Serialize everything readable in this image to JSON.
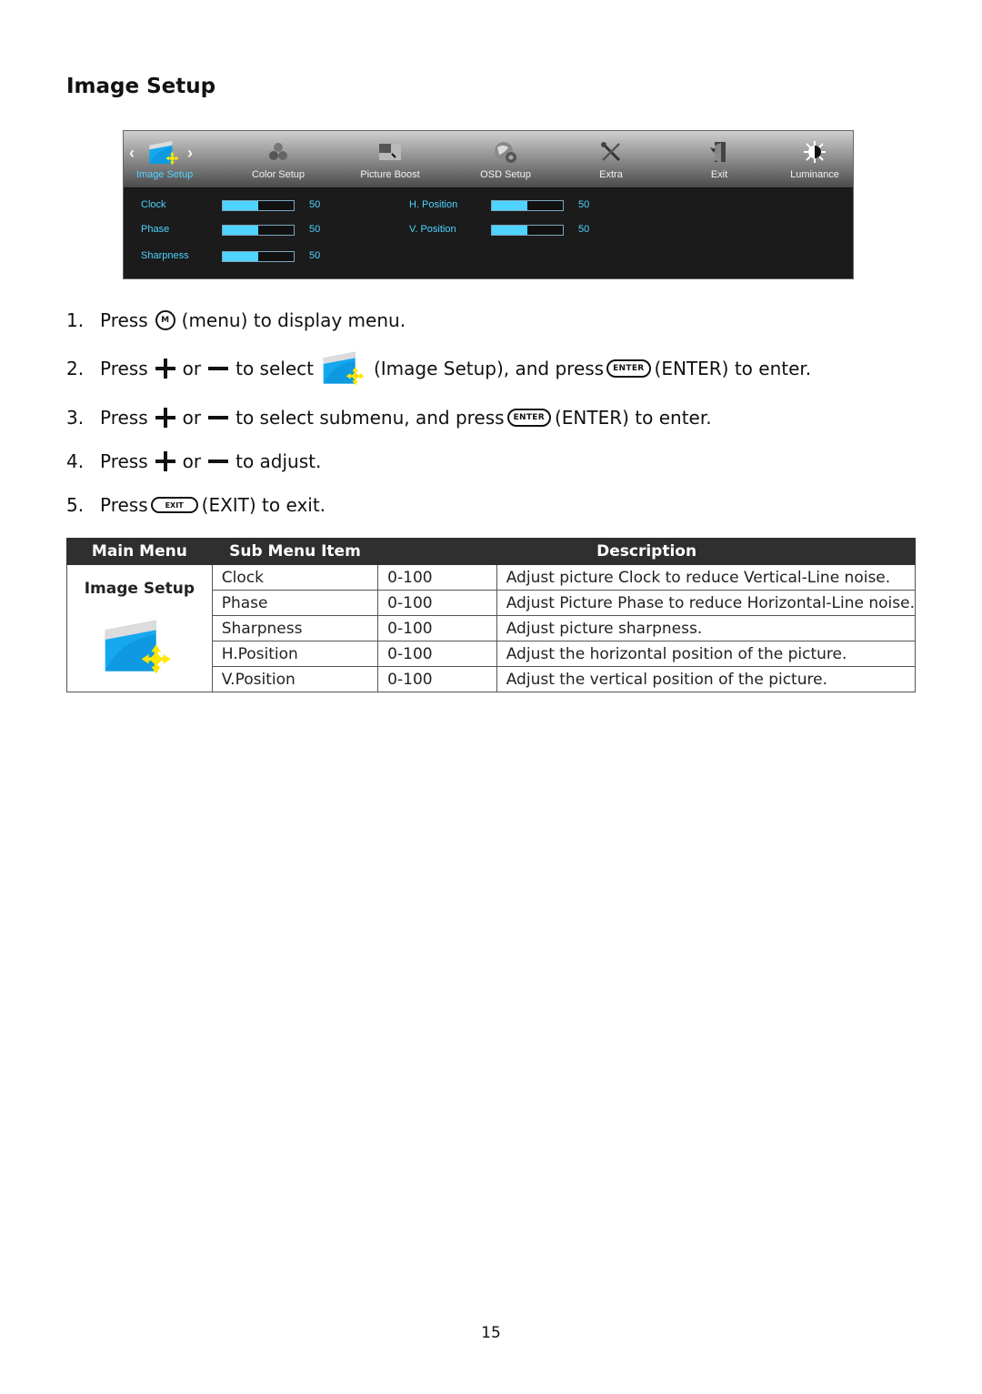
{
  "section_title": "Image Setup",
  "osd": {
    "tabs": [
      {
        "label": "Image Setup",
        "icon": "image-setup-icon",
        "active": true
      },
      {
        "label": "Color Setup",
        "icon": "color-setup-icon",
        "active": false
      },
      {
        "label": "Picture Boost",
        "icon": "picture-boost-icon",
        "active": false
      },
      {
        "label": "OSD Setup",
        "icon": "osd-setup-icon",
        "active": false
      },
      {
        "label": "Extra",
        "icon": "extra-icon",
        "active": false
      },
      {
        "label": "Exit",
        "icon": "exit-icon",
        "active": false
      },
      {
        "label": "Luminance",
        "icon": "luminance-icon",
        "active": false
      }
    ],
    "settings": [
      {
        "label": "Clock",
        "value": "50",
        "level": 0.5
      },
      {
        "label": "Phase",
        "value": "50",
        "level": 0.5
      },
      {
        "label": "Sharpness",
        "value": "50",
        "level": 0.5
      },
      {
        "label": "H. Position",
        "value": "50",
        "level": 0.5
      },
      {
        "label": "V. Position",
        "value": "50",
        "level": 0.5
      }
    ],
    "accent_color": "#4fd3ff"
  },
  "steps": [
    {
      "num": "1.",
      "parts": [
        "Press",
        "(menu) to display menu."
      ],
      "key": "M"
    },
    {
      "num": "2.",
      "parts": [
        "Press",
        "or",
        "to select",
        "(Image Setup), and press",
        "(ENTER) to enter."
      ],
      "key": "ENTER"
    },
    {
      "num": "3.",
      "parts": [
        "Press",
        "or",
        "to select submenu, and press",
        "(ENTER) to enter."
      ],
      "key": "ENTER"
    },
    {
      "num": "4.",
      "parts": [
        "Press",
        "or",
        "to adjust."
      ]
    },
    {
      "num": "5.",
      "parts": [
        "Press",
        "(EXIT) to exit."
      ],
      "key": "EXIT"
    }
  ],
  "table": {
    "headers": [
      "Main Menu",
      "Sub Menu Item",
      "Description"
    ],
    "main_menu": "Image Setup",
    "rows": [
      {
        "item": "Clock",
        "range": "0-100",
        "description": "Adjust picture Clock to reduce Vertical-Line noise."
      },
      {
        "item": "Phase",
        "range": "0-100",
        "description": "Adjust Picture Phase to reduce Horizontal-Line noise."
      },
      {
        "item": "Sharpness",
        "range": "0-100",
        "description": "Adjust picture sharpness."
      },
      {
        "item": "H.Position",
        "range": "0-100",
        "description": "Adjust the horizontal position of the picture."
      },
      {
        "item": "V.Position",
        "range": "0-100",
        "description": "Adjust the vertical position of the picture."
      }
    ]
  },
  "page_number": "15"
}
